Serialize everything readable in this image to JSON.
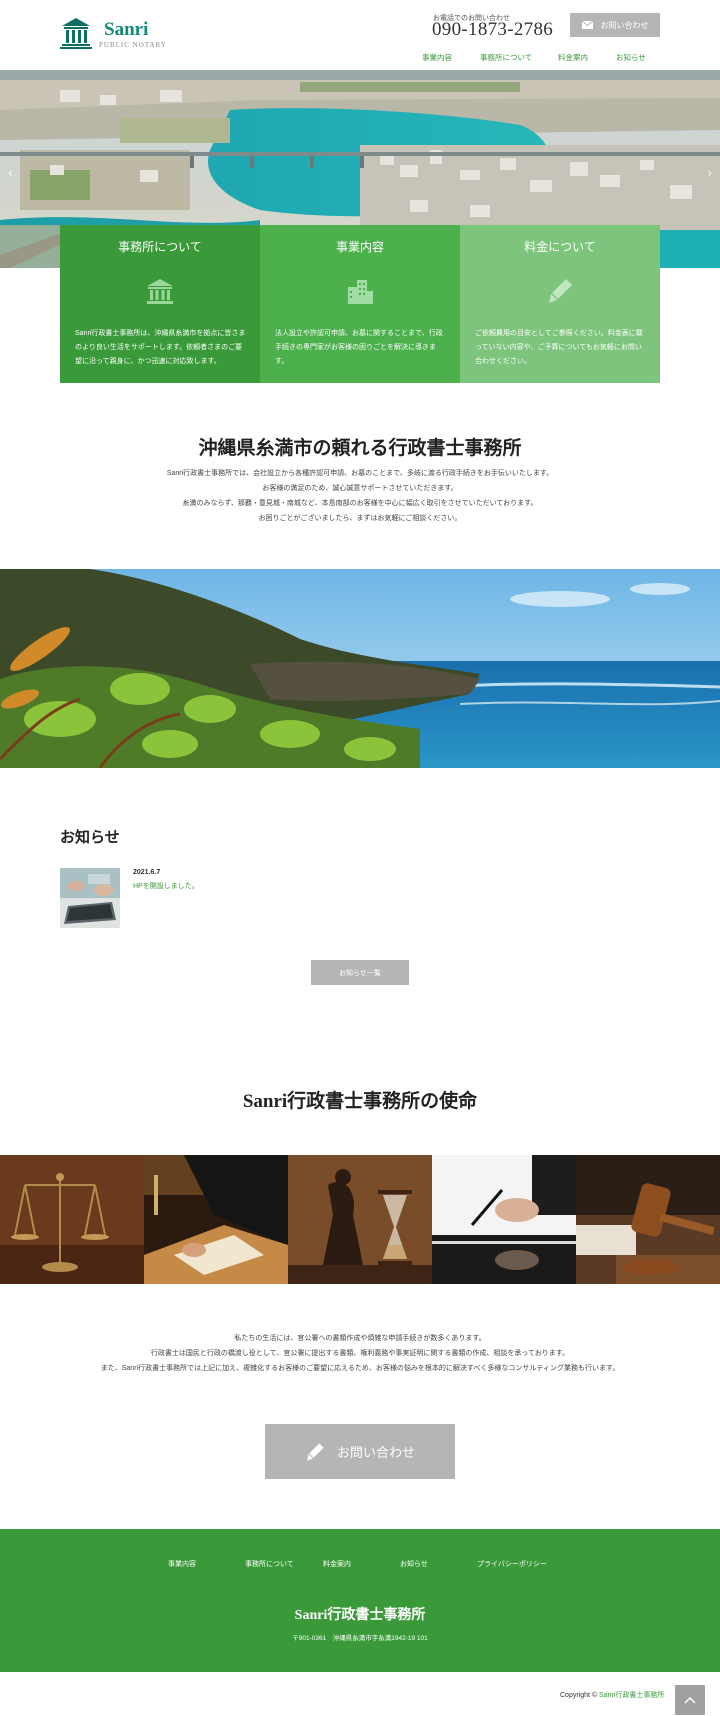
{
  "header": {
    "logo_name": "Sanri",
    "logo_sub": "PUBLIC NOTARY",
    "phone_caption": "お電話でのお問い合わせ",
    "phone_number": "090-1873-2786",
    "contact_label": "お問い合わせ"
  },
  "nav": [
    {
      "label": "事業内容"
    },
    {
      "label": "事務所について"
    },
    {
      "label": "料金案内"
    },
    {
      "label": "お知らせ"
    }
  ],
  "hero": {
    "prev_icon": "chevron-left-icon",
    "next_icon": "chevron-right-icon"
  },
  "features": [
    {
      "title": "事務所について",
      "icon": "building-columns-icon",
      "text": "Sanri行政書士事務所は、沖縄県糸満市を拠点に皆さまのより良い生活をサポートします。依頼者さまのご要望に沿って親身に、かつ迅速に対応致します。"
    },
    {
      "title": "事業内容",
      "icon": "buildings-icon",
      "text": "法人設立や許認可申請、お墓に関することまで、行政手続きの専門家がお客様の困りごとを解決に導きます。"
    },
    {
      "title": "料金について",
      "icon": "pen-icon",
      "text": "ご依頼費用の目安としてご参照ください。料金表に載っていない内容や、ご予算についてもお気軽にお問い合わせください。"
    }
  ],
  "intro": {
    "title": "沖縄県糸満市の頼れる行政書士事務所",
    "lines": [
      "Sanri行政書士事務所では、会社設立から各種許認可申請、お墓のことまで、多岐に渡る行政手続きをお手伝いいたします。",
      "お客様の満足のため、誠心誠意サポートさせていただきます。",
      "糸満のみならず、那覇・豊見城・南城など、本島南部のお客様を中心に幅広く取引をさせていただいております。",
      "お困りごとがございましたら、まずはお気軽にご相談ください。"
    ]
  },
  "news": {
    "title": "お知らせ",
    "items": [
      {
        "date": "2021.6.7",
        "text": "HPを開設しました。"
      }
    ],
    "more_label": "お知らせ一覧"
  },
  "mission": {
    "title": "Sanri行政書士事務所の使命",
    "lines": [
      "私たちの生活には、官公署への書類作成や煩雑な申請手続きが数多くあります。",
      "行政書士は国民と行政の橋渡し役として、官公署に提出する書類、権利義務や事実証明に関する書類の作成、相談を承っております。",
      "また、Sanri行政書士事務所では上記に加え、複雑化するお客様のご要望に応えるため、お客様の悩みを根本的に解決すべく多様なコンサルティング業務も行います。"
    ],
    "cta_label": "お問い合わせ"
  },
  "footer": {
    "nav": [
      {
        "label": "事業内容"
      },
      {
        "label": "事務所について"
      },
      {
        "label": "料金案内"
      },
      {
        "label": "お知らせ"
      },
      {
        "label": "プライバシーポリシー"
      }
    ],
    "name": "Sanri行政書士事務所",
    "address": "〒901-0361　沖縄県糸満市字糸満1942-19 101",
    "copyright_prefix": "Copyright ©",
    "copyright_owner": "Sanri行政書士事務所"
  },
  "colors": {
    "brand_green": "#3a9a3a",
    "mid_green": "#4cb04c",
    "light_green": "#7dc47d",
    "logo_teal": "#0e8a7b",
    "button_gray": "#b5b5b5"
  }
}
